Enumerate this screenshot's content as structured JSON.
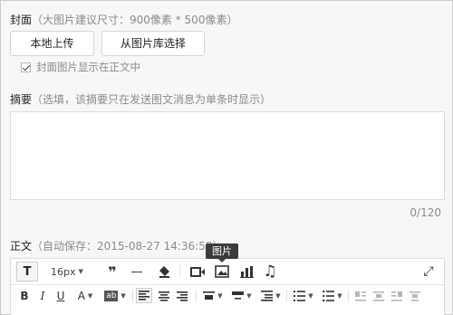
{
  "cover": {
    "title": "封面",
    "hint": "（大图片建议尺寸：900像素 * 500像素）",
    "upload_local_label": "本地上传",
    "choose_library_label": "从图片库选择",
    "show_in_body_label": "封面图片显示在正文中",
    "show_in_body_checked": true
  },
  "summary": {
    "title": "摘要",
    "hint": "（选填，该摘要只在发送图文消息为单条时显示）",
    "value": "",
    "counter": "0/120"
  },
  "body": {
    "title": "正文",
    "autosave": "（自动保存：2015-08-27 14:36:58）"
  },
  "tooltip": "图片",
  "toolbar": {
    "row1": [
      {
        "name": "text-format-button",
        "glyph": "T"
      },
      {
        "name": "font-size-dropdown",
        "value": "16px"
      },
      {
        "name": "quote-icon",
        "glyph": "❞"
      },
      {
        "name": "horizontal-rule-icon",
        "glyph": "—"
      },
      {
        "name": "clear-format-icon",
        "glyph": ""
      },
      {
        "name": "video-icon",
        "glyph": ""
      },
      {
        "name": "image-icon",
        "glyph": ""
      },
      {
        "name": "chart-icon",
        "glyph": ""
      },
      {
        "name": "music-icon",
        "glyph": "♫"
      },
      {
        "name": "fullscreen-icon",
        "glyph": "⤢"
      }
    ],
    "row2": [
      {
        "name": "bold-icon",
        "glyph": "B"
      },
      {
        "name": "italic-icon",
        "glyph": "I"
      },
      {
        "name": "underline-icon",
        "glyph": "U"
      },
      {
        "name": "font-color-icon",
        "glyph": "A"
      },
      {
        "name": "background-color-icon",
        "glyph": "ab"
      }
    ]
  }
}
